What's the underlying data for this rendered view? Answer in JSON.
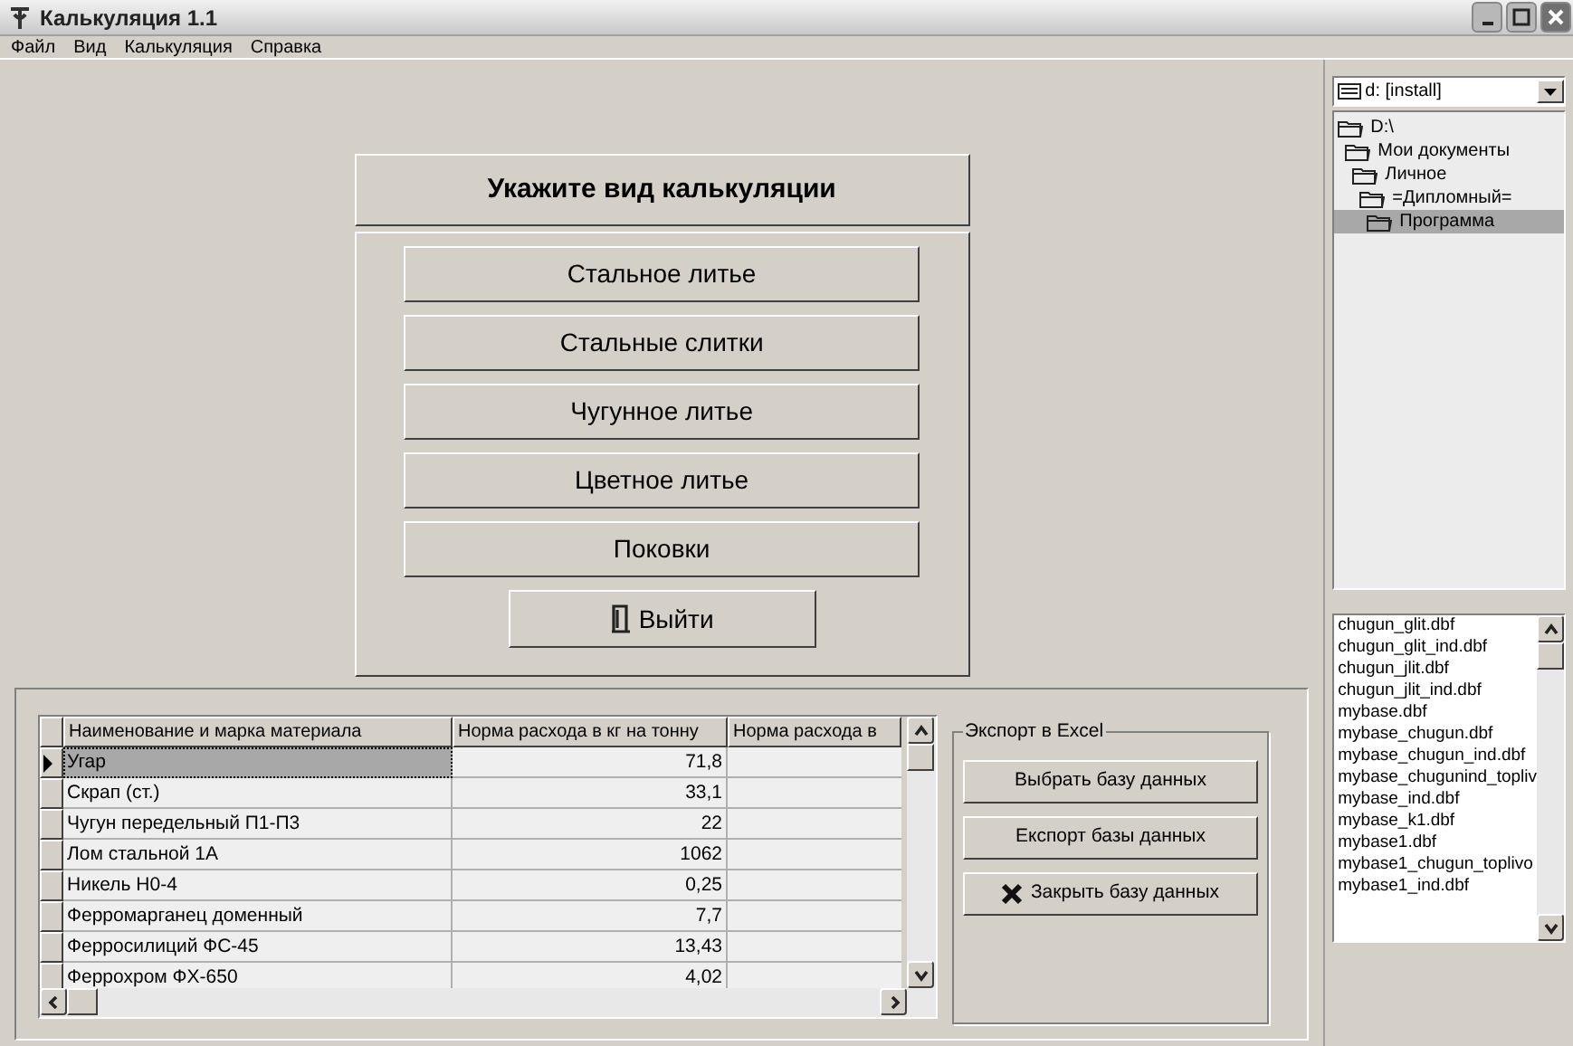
{
  "window": {
    "title": "Калькуляция 1.1"
  },
  "menu": [
    "Файл",
    "Вид",
    "Калькуляция",
    "Справка"
  ],
  "heading": "Укажите вид калькуляции",
  "calc_buttons": [
    {
      "label": "Стальное литье",
      "kind": "plain"
    },
    {
      "label": "Стальные слитки",
      "kind": "plain"
    },
    {
      "label": "Чугунное литье",
      "kind": "plain"
    },
    {
      "label": "Цветное литье",
      "kind": "plain"
    },
    {
      "label": "Поковки",
      "kind": "plain"
    },
    {
      "label": "Выйти",
      "kind": "exit"
    }
  ],
  "table": {
    "columns": [
      "Наименование и марка материала",
      "Норма расхода в кг на тонну",
      "Норма расхода в"
    ],
    "rows": [
      {
        "cells": [
          "Угар",
          "71,8"
        ],
        "selected": true
      },
      {
        "cells": [
          "Скрап (ст.)",
          "33,1"
        ],
        "selected": false
      },
      {
        "cells": [
          "Чугун передельный П1-П3",
          "22"
        ],
        "selected": false
      },
      {
        "cells": [
          "Лом стальной 1А",
          "1062"
        ],
        "selected": false
      },
      {
        "cells": [
          "Никель Н0-4",
          "0,25"
        ],
        "selected": false
      },
      {
        "cells": [
          "Ферромарганец доменный",
          "7,7"
        ],
        "selected": false
      },
      {
        "cells": [
          "Ферросилиций ФС-45",
          "13,43"
        ],
        "selected": false
      },
      {
        "cells": [
          "Феррохром ФХ-650",
          "4,02"
        ],
        "selected": false
      }
    ]
  },
  "export": {
    "title": "Экспорт в Excel",
    "buttons": [
      {
        "label": "Выбрать базу данных",
        "kind": "plain"
      },
      {
        "label": "Експорт базы данных",
        "kind": "plain"
      },
      {
        "label": "Закрыть базу данных",
        "kind": "close"
      }
    ]
  },
  "drive": "d: [install]",
  "tree": [
    {
      "label": "D:\\",
      "selected": false,
      "children": [
        {
          "label": "Мои документы",
          "selected": false,
          "children": [
            {
              "label": "Личное",
              "selected": false,
              "children": [
                {
                  "label": "=Дипломный=",
                  "selected": false,
                  "children": [
                    {
                      "label": "Программа",
                      "selected": true
                    }
                  ]
                }
              ]
            }
          ]
        }
      ]
    }
  ],
  "files": [
    "chugun_glit.dbf",
    "chugun_glit_ind.dbf",
    "chugun_jlit.dbf",
    "chugun_jlit_ind.dbf",
    "mybase.dbf",
    "mybase_chugun.dbf",
    "mybase_chugun_ind.dbf",
    "mybase_chugunind_topliv",
    "mybase_ind.dbf",
    "mybase_k1.dbf",
    "mybase1.dbf",
    "mybase1_chugun_toplivo",
    "mybase1_ind.dbf"
  ]
}
